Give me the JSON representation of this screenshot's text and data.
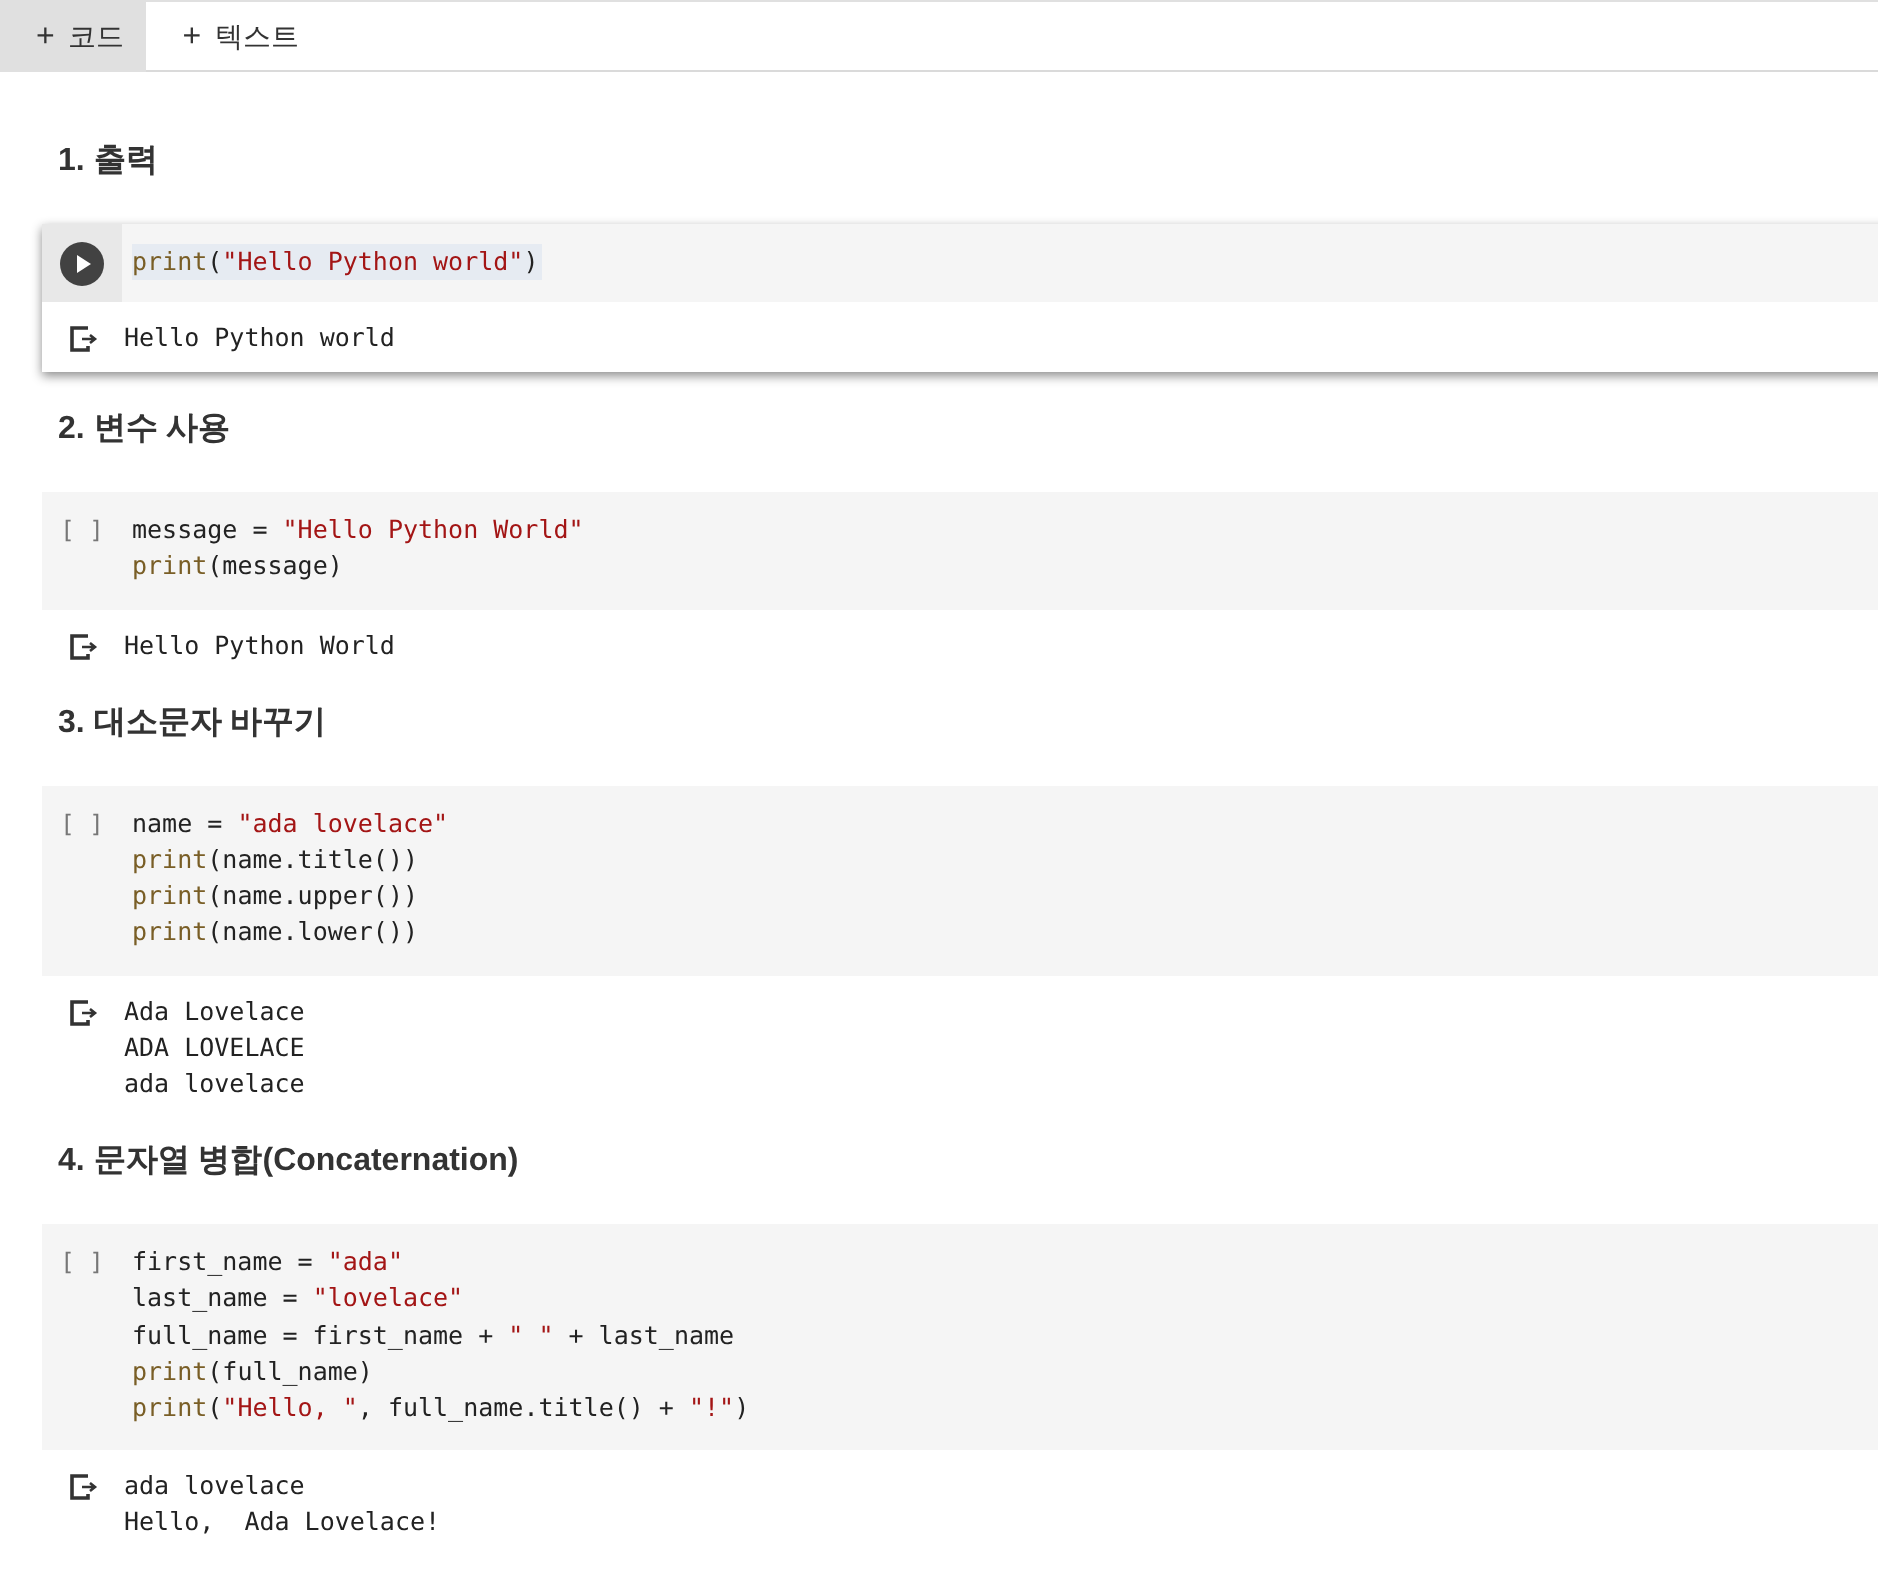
{
  "toolbar": [
    {
      "icon": "+",
      "label": "코드",
      "selected": true
    },
    {
      "icon": "+",
      "label": "텍스트",
      "selected": false
    }
  ],
  "sections": [
    {
      "heading": "1. 출력",
      "cell": {
        "active": true,
        "lines": [
          [
            {
              "kind": "fn",
              "text": "print"
            },
            {
              "kind": "p",
              "text": "("
            },
            {
              "kind": "str",
              "text": "\"Hello Python world\""
            },
            {
              "kind": "p",
              "text": ")"
            }
          ]
        ]
      },
      "output": [
        "Hello Python world"
      ]
    },
    {
      "heading": "2. 변수 사용",
      "cell": {
        "active": false,
        "prompt": "[ ]",
        "lines": [
          [
            {
              "kind": "p",
              "text": "message = "
            },
            {
              "kind": "str",
              "text": "\"Hello Python World\""
            }
          ],
          [
            {
              "kind": "fn",
              "text": "print"
            },
            {
              "kind": "p",
              "text": "(message)"
            }
          ]
        ]
      },
      "output": [
        "Hello Python World"
      ]
    },
    {
      "heading": "3. 대소문자 바꾸기",
      "cell": {
        "active": false,
        "prompt": "[ ]",
        "lines": [
          [
            {
              "kind": "p",
              "text": "name = "
            },
            {
              "kind": "str",
              "text": "\"ada lovelace\""
            }
          ],
          [
            {
              "kind": "fn",
              "text": "print"
            },
            {
              "kind": "p",
              "text": "(name.title())"
            }
          ],
          [
            {
              "kind": "fn",
              "text": "print"
            },
            {
              "kind": "p",
              "text": "(name.upper())"
            }
          ],
          [
            {
              "kind": "fn",
              "text": "print"
            },
            {
              "kind": "p",
              "text": "(name.lower())"
            }
          ]
        ]
      },
      "output": [
        "Ada Lovelace",
        "ADA LOVELACE",
        "ada lovelace"
      ]
    },
    {
      "heading": "4. 문자열 병합(Concaternation)",
      "cell": {
        "active": false,
        "prompt": "[ ]",
        "lines": [
          [
            {
              "kind": "p",
              "text": "first_name = "
            },
            {
              "kind": "str",
              "text": "\"ada\""
            }
          ],
          [
            {
              "kind": "p",
              "text": "last_name = "
            },
            {
              "kind": "str",
              "text": "\"lovelace\""
            }
          ],
          [
            {
              "kind": "p",
              "text": "full_name = first_name + "
            },
            {
              "kind": "str",
              "text": "\" \""
            },
            {
              "kind": "p",
              "text": " + last_name"
            }
          ],
          [
            {
              "kind": "fn",
              "text": "print"
            },
            {
              "kind": "p",
              "text": "(full_name)"
            }
          ],
          [
            {
              "kind": "fn",
              "text": "print"
            },
            {
              "kind": "p",
              "text": "("
            },
            {
              "kind": "str",
              "text": "\"Hello, \""
            },
            {
              "kind": "p",
              "text": ", full_name.title() + "
            },
            {
              "kind": "str",
              "text": "\"!\""
            },
            {
              "kind": "p",
              "text": ")"
            }
          ]
        ]
      },
      "output": [
        "ada lovelace",
        "Hello,  Ada Lovelace!"
      ]
    }
  ]
}
